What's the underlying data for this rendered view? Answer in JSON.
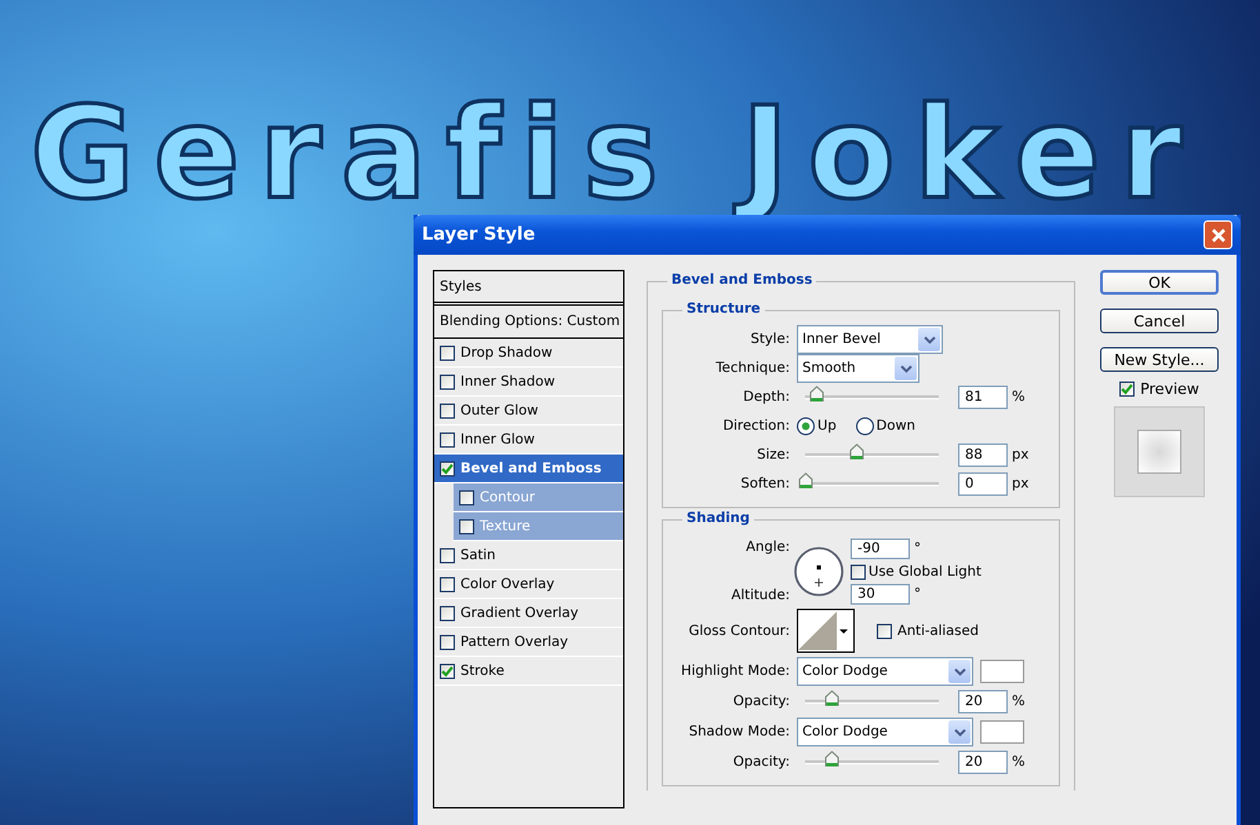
{
  "canvas": {
    "text": "Gerafis Joker"
  },
  "dialog": {
    "title": "Layer Style",
    "styles_list": [
      {
        "kind": "header",
        "label": "Styles",
        "selected": false
      },
      {
        "kind": "header",
        "label": "Blending Options: Custom",
        "selected": false
      },
      {
        "kind": "effect",
        "label": "Drop Shadow",
        "checked": false,
        "selected": false
      },
      {
        "kind": "effect",
        "label": "Inner Shadow",
        "checked": false,
        "selected": false
      },
      {
        "kind": "effect",
        "label": "Outer Glow",
        "checked": false,
        "selected": false
      },
      {
        "kind": "effect",
        "label": "Inner Glow",
        "checked": false,
        "selected": false
      },
      {
        "kind": "effect",
        "label": "Bevel and Emboss",
        "checked": true,
        "selected": true,
        "children": [
          {
            "kind": "effect",
            "label": "Contour",
            "checked": false,
            "selected": false
          },
          {
            "kind": "effect",
            "label": "Texture",
            "checked": false,
            "selected": false
          }
        ]
      },
      {
        "kind": "effect",
        "label": "Satin",
        "checked": false,
        "selected": false
      },
      {
        "kind": "effect",
        "label": "Color Overlay",
        "checked": false,
        "selected": false
      },
      {
        "kind": "effect",
        "label": "Gradient Overlay",
        "checked": false,
        "selected": false
      },
      {
        "kind": "effect",
        "label": "Pattern Overlay",
        "checked": false,
        "selected": false
      },
      {
        "kind": "effect",
        "label": "Stroke",
        "checked": true,
        "selected": false
      }
    ],
    "section_title": "Bevel and Emboss",
    "structure": {
      "title": "Structure",
      "rows": [
        {
          "kind": "dropdown",
          "label": "Style:",
          "value": "Inner Bevel",
          "wide": true
        },
        {
          "kind": "dropdown",
          "label": "Technique:",
          "value": "Smooth",
          "wide": false
        },
        {
          "kind": "slider",
          "label": "Depth:",
          "level": 0.08,
          "value": "81",
          "unit": "%"
        },
        {
          "kind": "radio",
          "label": "Direction:",
          "options": [
            {
              "label": "Up",
              "selected": true
            },
            {
              "label": "Down",
              "selected": false
            }
          ]
        },
        {
          "kind": "slider",
          "label": "Size:",
          "level": 0.38,
          "value": "88",
          "unit": "px"
        },
        {
          "kind": "slider",
          "label": "Soften:",
          "level": 0,
          "value": "0",
          "unit": "px"
        }
      ]
    },
    "shading": {
      "title": "Shading",
      "angle": {
        "label": "Angle:",
        "value": "-90",
        "unit": "°"
      },
      "global_light": {
        "label": "Use Global Light",
        "checked": false
      },
      "altitude": {
        "label": "Altitude:",
        "value": "30",
        "unit": "°"
      },
      "gloss_contour": {
        "label": "Gloss Contour:"
      },
      "anti_aliased": {
        "label": "Anti-aliased",
        "checked": false
      },
      "rows": [
        {
          "kind": "mode",
          "label": "Highlight Mode:",
          "value": "Color Dodge"
        },
        {
          "kind": "slider",
          "label": "Opacity:",
          "level": 0.2,
          "value": "20",
          "unit": "%"
        },
        {
          "kind": "mode",
          "label": "Shadow Mode:",
          "value": "Color Dodge"
        },
        {
          "kind": "slider",
          "label": "Opacity:",
          "level": 0.2,
          "value": "20",
          "unit": "%"
        }
      ]
    },
    "buttons": [
      {
        "label": "OK",
        "default": true
      },
      {
        "label": "Cancel",
        "default": false
      },
      {
        "label": "New Style...",
        "default": false
      }
    ],
    "preview": {
      "label": "Preview",
      "checked": true
    }
  }
}
